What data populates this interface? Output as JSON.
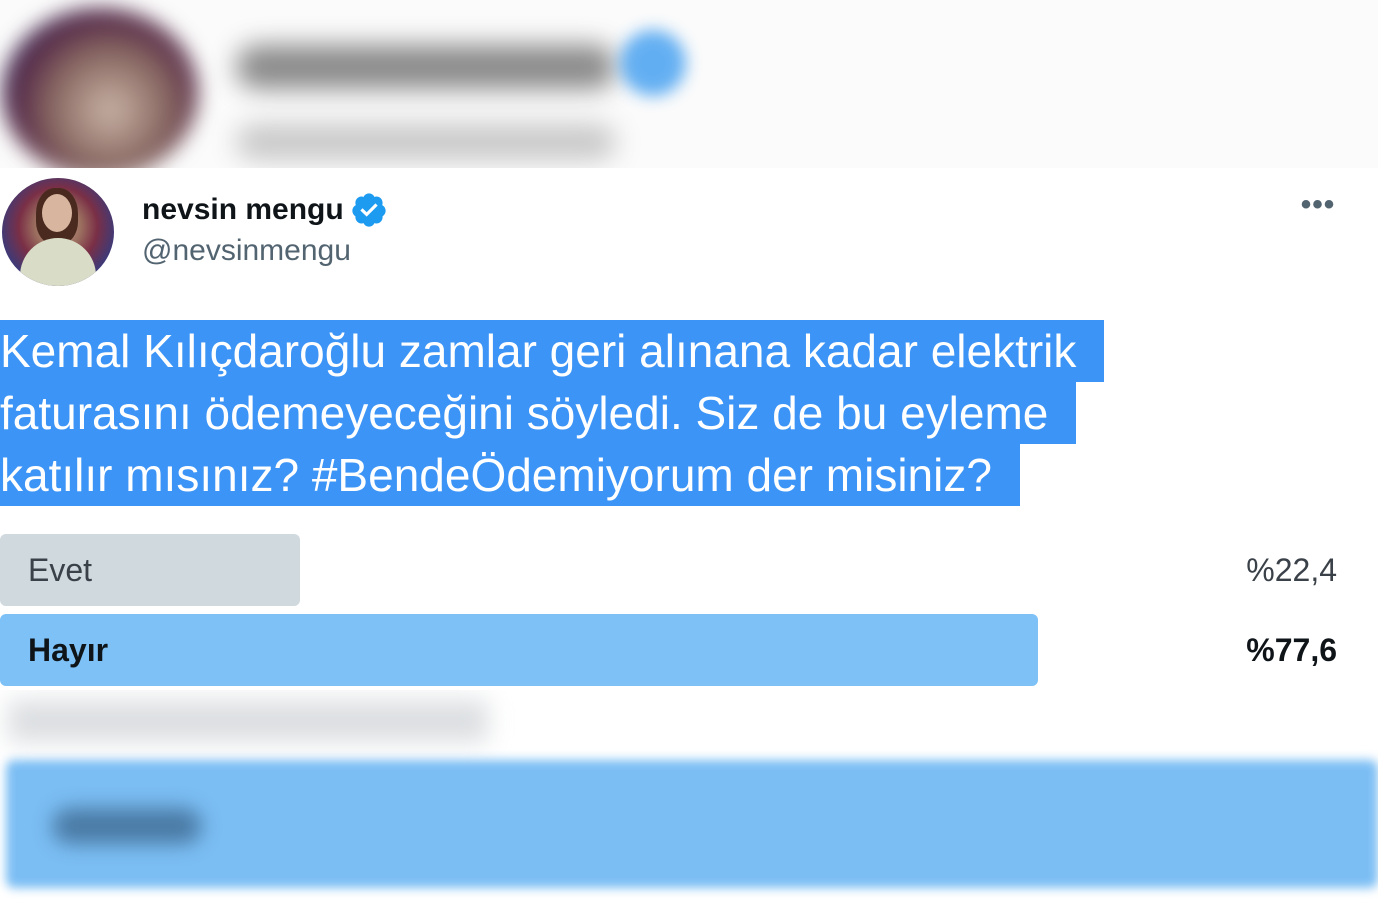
{
  "tweet": {
    "display_name": "nevsin mengu",
    "handle": "@nevsinmengu",
    "verified_icon": "verified-badge-icon",
    "more_label": "•••",
    "text_lines": [
      "Kemal Kılıçdaroğlu zamlar geri alınana kadar elektrik",
      "faturasını ödemeyeceğini söyledi. Siz de bu eyleme",
      "katılır mısınız? #BendeÖdemiyorum der misiniz?"
    ]
  },
  "poll": {
    "options": [
      {
        "label": "Evet",
        "percent_label": "%22,4",
        "share": 0.224
      },
      {
        "label": "Hayır",
        "percent_label": "%77,6",
        "share": 0.776
      }
    ]
  },
  "colors": {
    "selection_highlight": "#3c94f6",
    "poll_bar_winner": "#7dc1f6",
    "poll_bar_other": "#cfd9de",
    "verified_blue": "#1d9bf0"
  }
}
